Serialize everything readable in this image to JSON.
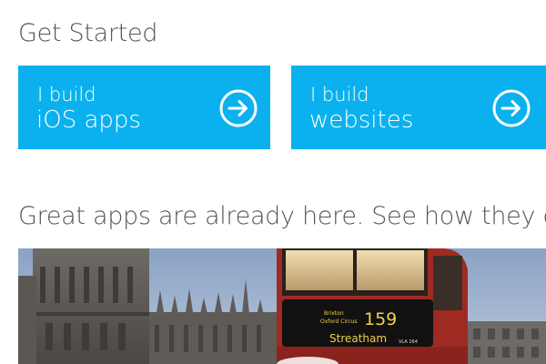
{
  "heading": "Get Started",
  "tiles": [
    {
      "small": "I build",
      "big": "iOS apps",
      "icon": "arrow-right-circle-icon"
    },
    {
      "small": "I build",
      "big": "websites",
      "icon": "arrow-right-circle-icon"
    }
  ],
  "subheading": "Great apps are already here. See how they did it",
  "photo": {
    "bus_sign_line1": "Brixton",
    "bus_sign_line2": "Oxford Circus",
    "bus_route": "159",
    "bus_destination": "Streatham",
    "bus_plate": "VLA 164"
  },
  "colors": {
    "tile_bg": "#0bb1ee",
    "heading_text": "#555555"
  }
}
